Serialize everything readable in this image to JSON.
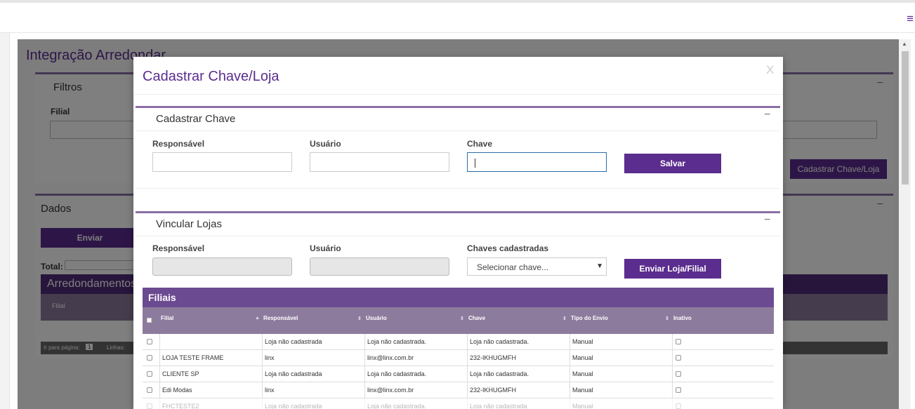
{
  "topbar": {
    "menu_icon": "≡"
  },
  "background": {
    "title": "Integração Arredondar",
    "filtros": {
      "title": "Filtros",
      "filial_label": "Filial",
      "btn_cadastrar": "Cadastrar Chave/Loja"
    },
    "dados": {
      "title": "Dados",
      "btn_enviar": "Enviar",
      "total_label": "Total:",
      "grid_title": "Arredondamentos",
      "col_filial": "Filial",
      "pager_label": "Ir para página:",
      "pager_value": "1",
      "linhas_label": "Linhas:"
    }
  },
  "modal": {
    "title": "Cadastrar Chave/Loja",
    "close": "X",
    "cadastrar": {
      "title": "Cadastrar Chave",
      "minimize": "−",
      "responsavel_label": "Responsável",
      "usuario_label": "Usuário",
      "chave_label": "Chave",
      "salvar": "Salvar"
    },
    "vincular": {
      "title": "Vincular Lojas",
      "minimize": "−",
      "responsavel_label": "Responsável",
      "usuario_label": "Usuário",
      "chaves_label": "Chaves cadastradas",
      "select_value": "Selecionar chave...",
      "enviar": "Enviar Loja/Filial"
    },
    "filiais": {
      "title": "Filiais",
      "columns": [
        "Filial",
        "Responsável",
        "Usuário",
        "Chave",
        "Tipo do Envio",
        "Inativo"
      ],
      "rows": [
        [
          "",
          "Loja não cadastrada",
          "Loja não cadastrada.",
          "Loja não cadastrada.",
          "Manual"
        ],
        [
          "LOJA TESTE FRAME",
          "linx",
          "linx@linx.com.br",
          "232-IKHUGMFH",
          "Manual"
        ],
        [
          "CLIENTE SP",
          "Loja não cadastrada",
          "Loja não cadastrada.",
          "Loja não cadastrada.",
          "Manual"
        ],
        [
          "Edi Modas",
          "linx",
          "linx@linx.com.br",
          "232-IKHUGMFH",
          "Manual"
        ],
        [
          "FHCTESTE2",
          "Loja não cadastrada",
          "Loja não cadastrada.",
          "Loja não cadastrada",
          "Manual"
        ]
      ]
    }
  }
}
